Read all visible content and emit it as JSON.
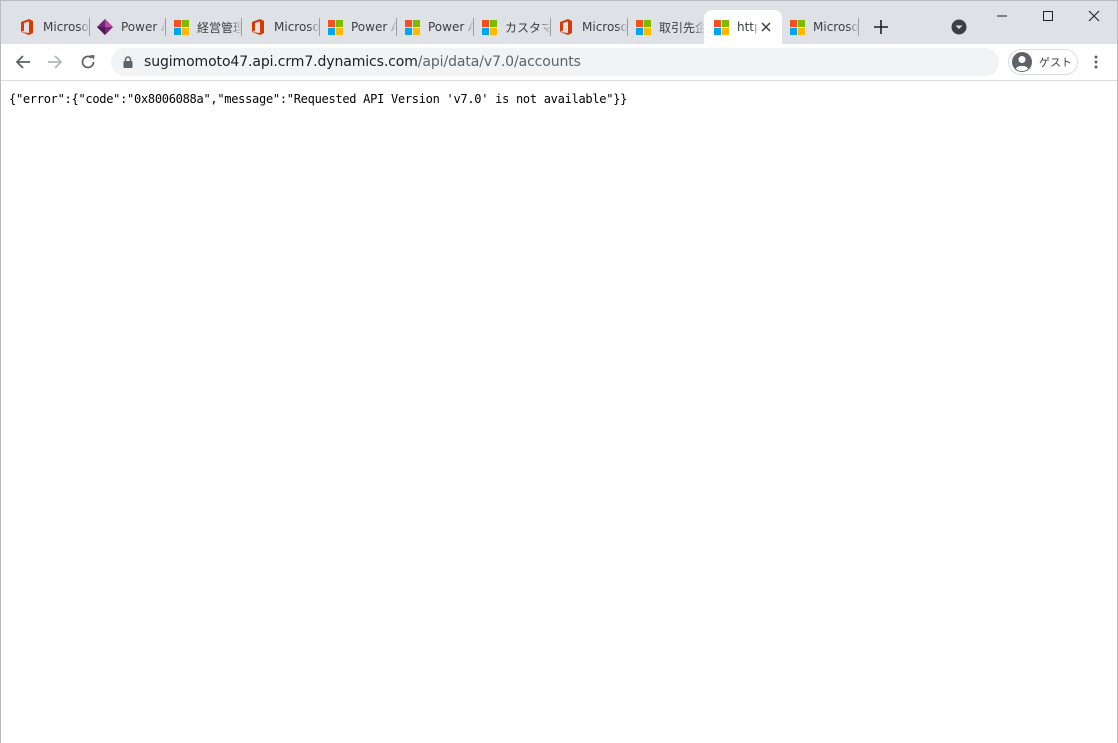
{
  "browser": {
    "tabs": [
      {
        "title": "Microsoft",
        "icon": "office-icon"
      },
      {
        "title": "Power Apps",
        "icon": "powerapps-icon"
      },
      {
        "title": "経営管理",
        "icon": "microsoft-logo-icon"
      },
      {
        "title": "Microsoft",
        "icon": "office-icon"
      },
      {
        "title": "Power Apps",
        "icon": "microsoft-logo-icon"
      },
      {
        "title": "Power Apps",
        "icon": "microsoft-logo-icon"
      },
      {
        "title": "カスタマー",
        "icon": "microsoft-logo-icon"
      },
      {
        "title": "Microsoft",
        "icon": "office-icon"
      },
      {
        "title": "取引先企業",
        "icon": "microsoft-logo-icon"
      },
      {
        "title": "https://",
        "icon": "microsoft-logo-icon",
        "active": true
      },
      {
        "title": "Microsoft",
        "icon": "microsoft-logo-icon"
      }
    ],
    "address_bar": {
      "host": "sugimomoto47.api.crm7.dynamics.com",
      "path": "/api/data/v7.0/accounts"
    },
    "profile_label": "ゲスト"
  },
  "page": {
    "body_text": "{\"error\":{\"code\":\"0x8006088a\",\"message\":\"Requested API Version 'v7.0' is not available\"}}"
  },
  "colors": {
    "tabstrip": "#dee1e6",
    "omnibox": "#f1f3f4",
    "office_red": "#d83b01",
    "powerapps_purple": "#742774"
  }
}
